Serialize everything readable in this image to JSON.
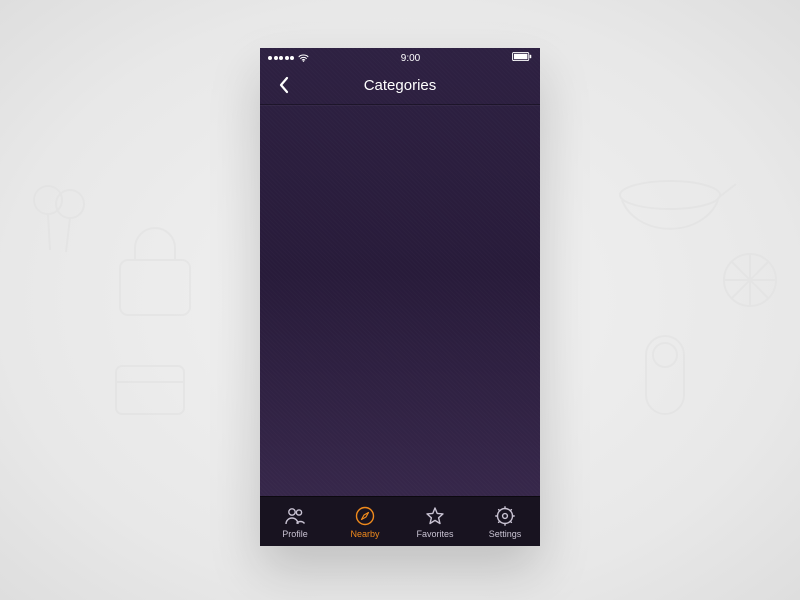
{
  "status_bar": {
    "time": "9:00"
  },
  "nav": {
    "title": "Categories"
  },
  "tabs": [
    {
      "id": "profile",
      "label": "Profile",
      "active": false
    },
    {
      "id": "nearby",
      "label": "Nearby",
      "active": true
    },
    {
      "id": "favorites",
      "label": "Favorites",
      "active": false
    },
    {
      "id": "settings",
      "label": "Settings",
      "active": false
    }
  ],
  "colors": {
    "accent": "#f08a1c"
  }
}
